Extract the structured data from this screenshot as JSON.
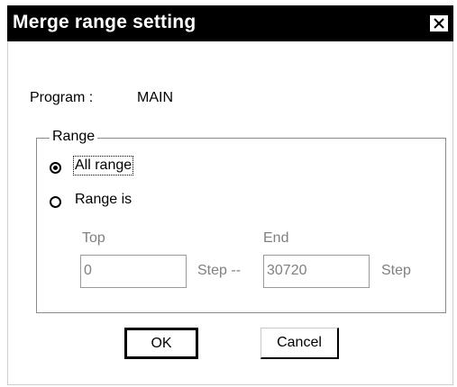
{
  "dialog": {
    "title": "Merge range setting",
    "close_glyph": "✕"
  },
  "program": {
    "label": "Program :",
    "value": "MAIN"
  },
  "range": {
    "group_label": "Range",
    "all_range_label": "All range",
    "range_is_label": "Range is",
    "selected": "All range",
    "top_label": "Top",
    "end_label": "End",
    "top_value": "0",
    "end_value": "30720",
    "step_between": "Step --",
    "step_after": "Step"
  },
  "buttons": {
    "ok": "OK",
    "cancel": "Cancel"
  }
}
